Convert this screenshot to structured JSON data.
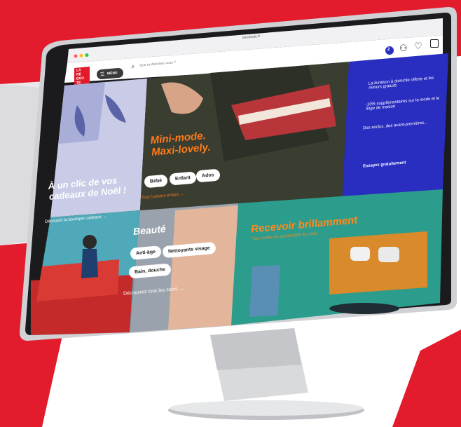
{
  "browser": {
    "url": "laredoute.fr"
  },
  "header": {
    "logo_lines": [
      "LA",
      "RE",
      "DOU",
      "TE"
    ],
    "menu_label": "MENU",
    "search_placeholder": "Que recherchez-vous ?",
    "account_badge": "2"
  },
  "hero_kids": {
    "title_line1": "Mini-mode.",
    "title_line2": "Maxi-lovely.",
    "pills": [
      "Bébé",
      "Enfant",
      "Ados"
    ],
    "link": "Tout l'univers enfant →"
  },
  "promo": {
    "items": [
      "La livraison à domicile offerte et les retours gratuits",
      "-10% supplémentaires sur la mode et le linge de maison",
      "Des exclus, des avant-premières..."
    ],
    "cta": "Essayez gratuitement"
  },
  "noel": {
    "title_line1": "À un clic de vos",
    "title_line2": "cadeaux de Noël !",
    "link": "Découvrir la boutique cadeaux →"
  },
  "beaute": {
    "title": "Beauté",
    "pills": [
      "Anti-âge",
      "Nettoyants visage",
      "Bain, douche"
    ],
    "link": "Découvrez tous les soins →"
  },
  "maison": {
    "title": "Recevoir brillamment",
    "link": "Vos invités en auront plein les yeux →"
  },
  "colors": {
    "brand_red": "#e11b2a",
    "promo_blue": "#2a2ec0",
    "accent_orange": "#ff7a1a",
    "beauty_gray": "#9aa3ad",
    "teal_wall": "#2c9c8c"
  }
}
